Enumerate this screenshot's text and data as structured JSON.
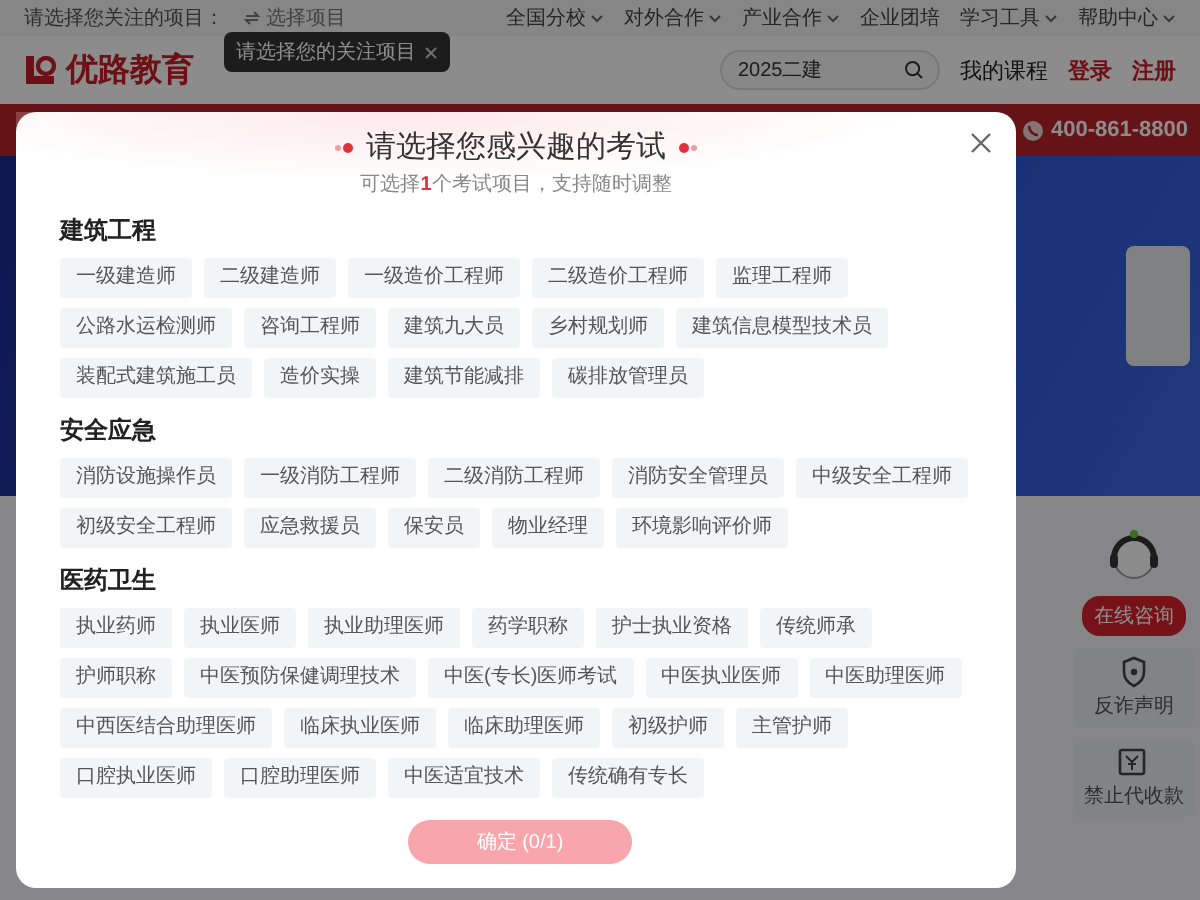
{
  "top_bar": {
    "prompt": "请选择您关注的项目：",
    "project_picker": "选择项目",
    "links": [
      "全国分校",
      "对外合作",
      "产业合作",
      "企业团培",
      "学习工具",
      "帮助中心"
    ],
    "link_dropdown": [
      true,
      true,
      true,
      false,
      true,
      true
    ]
  },
  "tooltip": {
    "text": "请选择您的关注项目"
  },
  "header": {
    "logo": "优路教育",
    "search": {
      "value": "2025二建"
    },
    "my_courses": "我的课程",
    "login": "登录",
    "register": "注册"
  },
  "nav": {
    "phone": "400-861-8800"
  },
  "side_tools": [
    {
      "kind": "consult",
      "label": "在线咨询"
    },
    {
      "kind": "shield",
      "label": "反诈声明"
    },
    {
      "kind": "money",
      "label": "禁止代收款"
    }
  ],
  "modal": {
    "title": "请选择您感兴趣的考试",
    "subtitle": "可选择**1**个考试项目，支持随时调整",
    "groups": [
      {
        "title": "建筑工程",
        "options": [
          {
            "label": "一级建造师",
            "selected": false
          },
          {
            "label": "二级建造师",
            "selected": false
          },
          {
            "label": "一级造价工程师",
            "selected": false
          },
          {
            "label": "二级造价工程师",
            "selected": false
          },
          {
            "label": "监理工程师",
            "selected": false
          },
          {
            "label": "公路水运检测师",
            "selected": false
          },
          {
            "label": "咨询工程师",
            "selected": false
          },
          {
            "label": "建筑九大员",
            "selected": false
          },
          {
            "label": "乡村规划师",
            "selected": false
          },
          {
            "label": "建筑信息模型技术员",
            "selected": false
          },
          {
            "label": "装配式建筑施工员",
            "selected": false
          },
          {
            "label": "造价实操",
            "selected": false
          },
          {
            "label": "建筑节能减排",
            "selected": false
          },
          {
            "label": "碳排放管理员",
            "selected": false
          }
        ]
      },
      {
        "title": "安全应急",
        "options": [
          {
            "label": "消防设施操作员",
            "selected": false
          },
          {
            "label": "一级消防工程师",
            "selected": false
          },
          {
            "label": "二级消防工程师",
            "selected": false
          },
          {
            "label": "消防安全管理员",
            "selected": false
          },
          {
            "label": "中级安全工程师",
            "selected": false
          },
          {
            "label": "初级安全工程师",
            "selected": false
          },
          {
            "label": "应急救援员",
            "selected": false
          },
          {
            "label": "保安员",
            "selected": false
          },
          {
            "label": "物业经理",
            "selected": false
          },
          {
            "label": "环境影响评价师",
            "selected": false
          }
        ]
      },
      {
        "title": "医药卫生",
        "options": [
          {
            "label": "执业药师",
            "selected": false
          },
          {
            "label": "执业医师",
            "selected": false
          },
          {
            "label": "执业助理医师",
            "selected": false
          },
          {
            "label": "药学职称",
            "selected": false
          },
          {
            "label": "护士执业资格",
            "selected": false
          },
          {
            "label": "传统师承",
            "selected": false
          },
          {
            "label": "护师职称",
            "selected": false
          },
          {
            "label": "中医预防保健调理技术",
            "selected": false
          },
          {
            "label": "中医(专长)医师考试",
            "selected": false
          },
          {
            "label": "中医执业医师",
            "selected": false
          },
          {
            "label": "中医助理医师",
            "selected": false
          },
          {
            "label": "中西医结合助理医师",
            "selected": false
          },
          {
            "label": "临床执业医师",
            "selected": false
          },
          {
            "label": "临床助理医师",
            "selected": false
          },
          {
            "label": "初级护师",
            "selected": false
          },
          {
            "label": "主管护师",
            "selected": false
          },
          {
            "label": "口腔执业医师",
            "selected": false
          },
          {
            "label": "口腔助理医师",
            "selected": false
          },
          {
            "label": "中医适宜技术",
            "selected": false
          },
          {
            "label": "传统确有专长",
            "selected": false
          }
        ]
      }
    ],
    "confirm": {
      "label": "确定 (0/1)",
      "disabled": true
    }
  }
}
